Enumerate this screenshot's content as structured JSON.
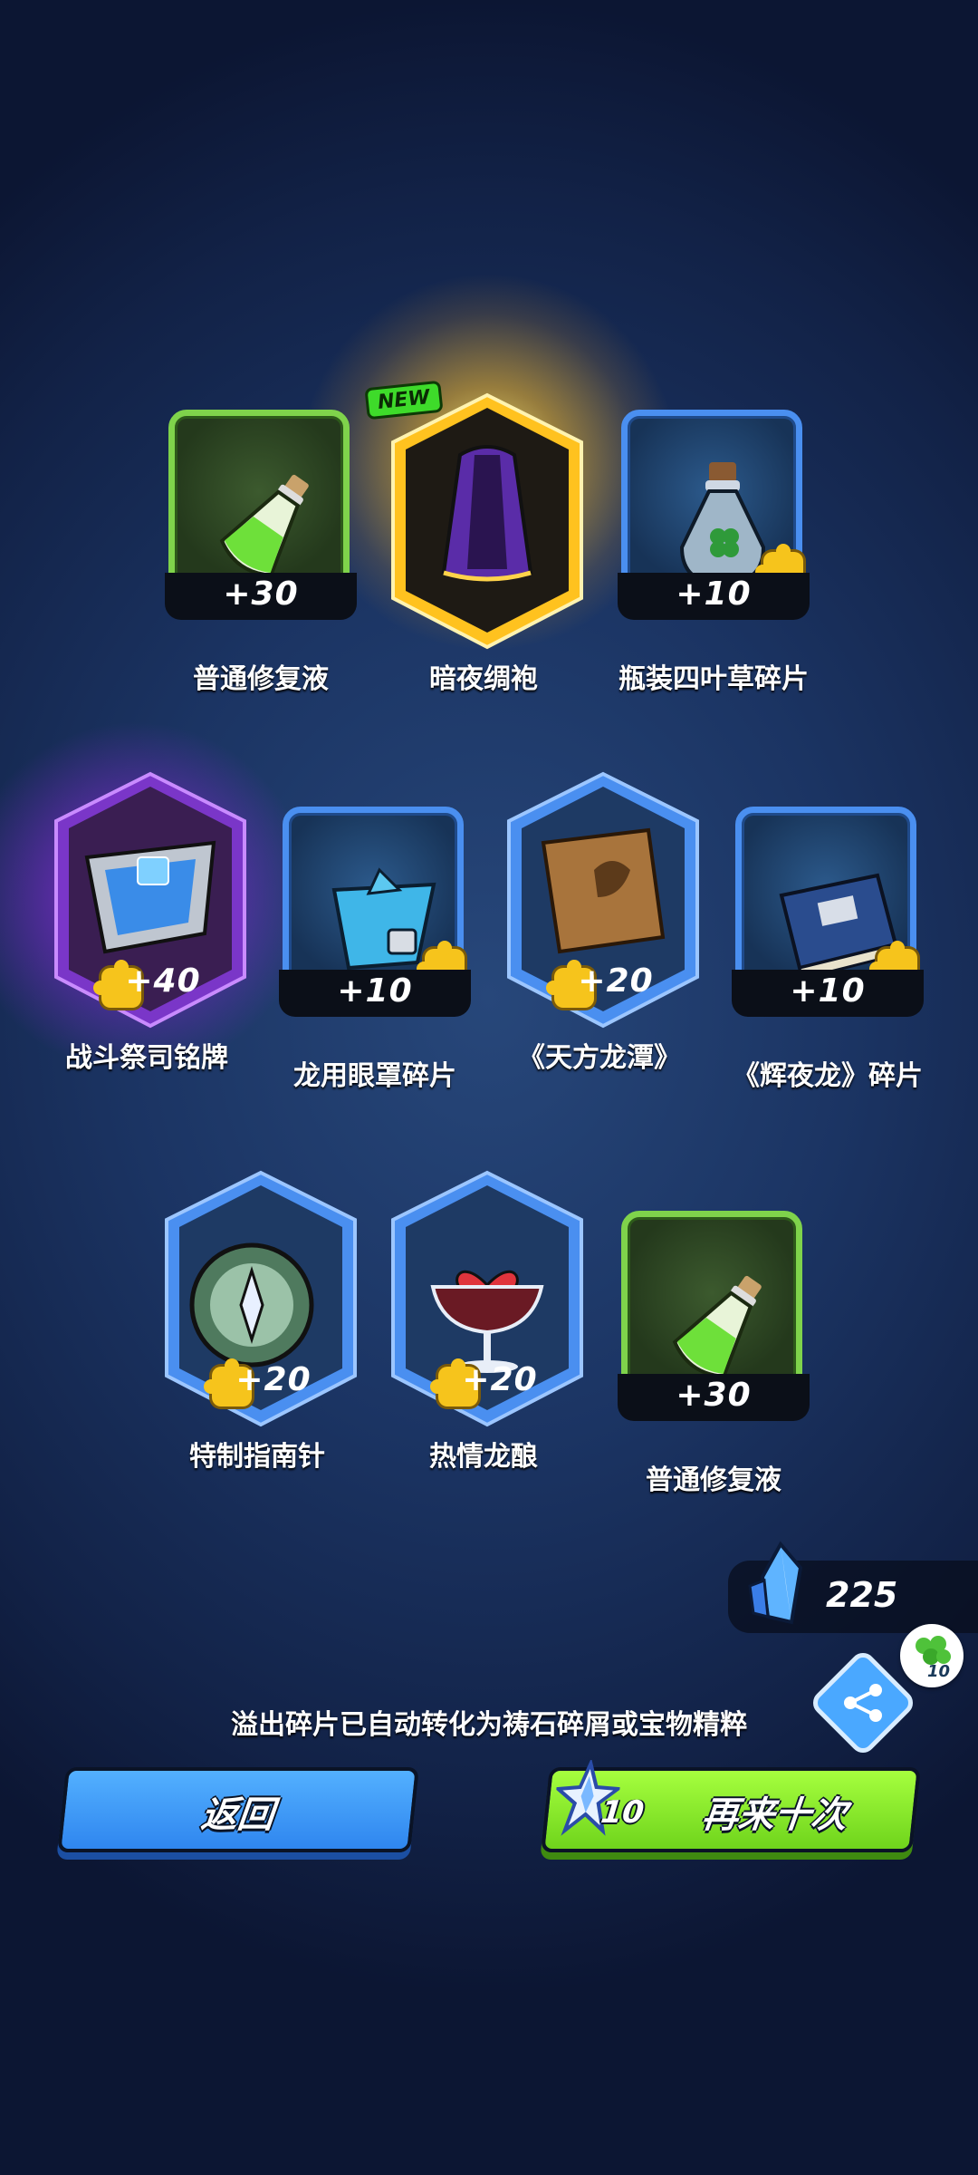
{
  "rewards": [
    {
      "name": "普通修复液",
      "count": "+30"
    },
    {
      "name": "暗夜绸袍",
      "badge": "NEW"
    },
    {
      "name": "瓶装四叶草碎片",
      "count": "+10"
    },
    {
      "name": "战斗祭司铭牌",
      "count": "+40"
    },
    {
      "name": "龙用眼罩碎片",
      "count": "+10"
    },
    {
      "name": "《天方龙潭》",
      "count": "+20"
    },
    {
      "name": "《辉夜龙》碎片",
      "count": "+10"
    },
    {
      "name": "特制指南针",
      "count": "+20"
    },
    {
      "name": "热情龙酿",
      "count": "+20"
    },
    {
      "name": "普通修复液",
      "count": "+30"
    }
  ],
  "currency": {
    "crystal_count": "225",
    "bubble_count": "10"
  },
  "hint_text": "溢出碎片已自动转化为祷石碎屑或宝物精粹",
  "buttons": {
    "back_label": "返回",
    "again_label": "再来十次",
    "again_cost": "10"
  },
  "colors": {
    "green_frame": "#7fd34b",
    "blue_frame": "#4a8ff0",
    "gold_glow": "#ffbe28",
    "purple_glow": "#be3cff",
    "back_button": "#2f86ef",
    "again_button": "#6fd41c"
  }
}
